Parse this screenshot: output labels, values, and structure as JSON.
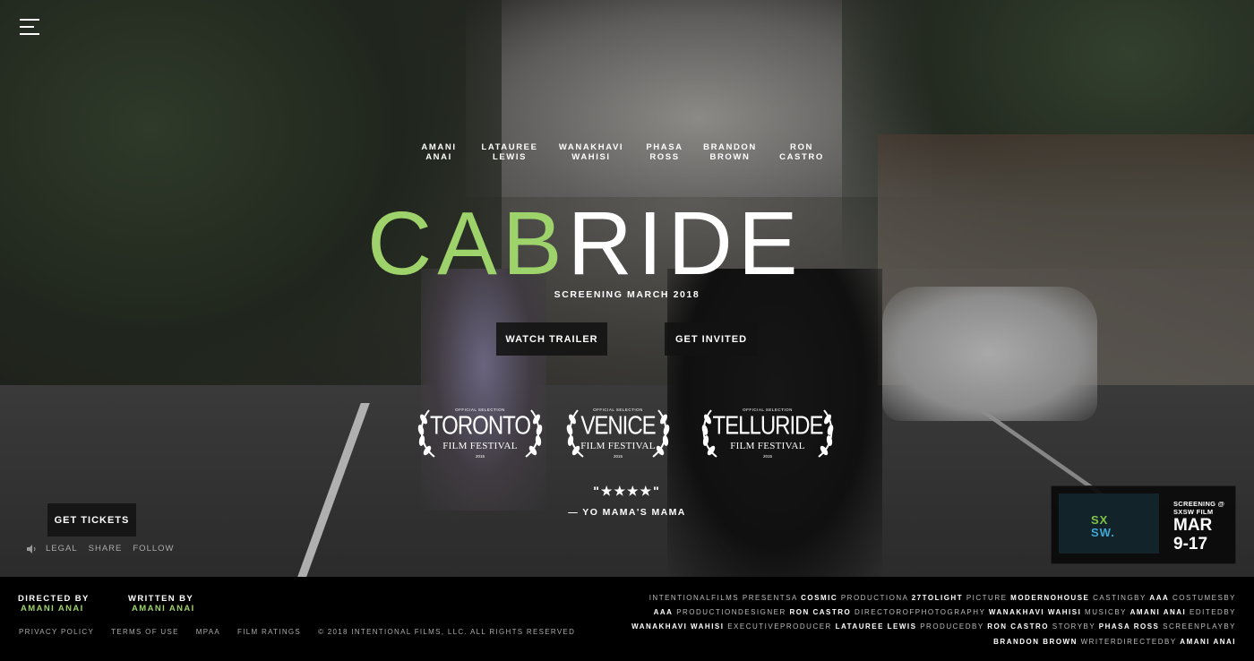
{
  "cast": [
    {
      "first": "AMANI",
      "last": "ANAI"
    },
    {
      "first": "LATAUREE",
      "last": "LEWIS"
    },
    {
      "first": "WANAKHAVI",
      "last": "WAHISI"
    },
    {
      "first": "PHASA",
      "last": "ROSS"
    },
    {
      "first": "BRANDON",
      "last": "BROWN"
    },
    {
      "first": "RON",
      "last": "CASTRO"
    }
  ],
  "title": {
    "part1": "CAB",
    "part2": "RIDE",
    "accent": "#9ed26a"
  },
  "screening": "SCREENING MARCH 2018",
  "buttons": {
    "trailer": "WATCH TRAILER",
    "invited": "GET INVITED",
    "tickets": "GET TICKETS"
  },
  "laurels": [
    {
      "selection": "OFFICIAL SELECTION",
      "name": "TORONTO",
      "festival": "FILM FESTIVAL",
      "year": "2015"
    },
    {
      "selection": "OFFICIAL SELECTION",
      "name": "VENICE",
      "festival": "FILM FESTIVAL",
      "year": "2015"
    },
    {
      "selection": "OFFICIAL SELECTION",
      "name": "TELLURIDE",
      "festival": "FILM FESTIVAL",
      "year": "2015"
    }
  ],
  "review": {
    "stars": "\"★★★★\"",
    "by": "— YO MAMA'S MAMA"
  },
  "mini_links": {
    "legal": "LEGAL",
    "share": "SHARE",
    "follow": "FOLLOW"
  },
  "sxsw": {
    "logo_line1": "SX",
    "logo_line2": "SW.",
    "screening_line1": "SCREENING @",
    "screening_line2": "SXSW FILM",
    "month": "MAR",
    "days": "9-17"
  },
  "footer": {
    "directed_label": "DIRECTED BY",
    "directed_name": "AMANI ANAI",
    "written_label": "WRITTEN BY",
    "written_name": "AMANI ANAI",
    "links": {
      "privacy": "PRIVACY POLICY",
      "terms": "TERMS OF USE",
      "mpaa": "MPAA",
      "ratings": "FILM RATINGS",
      "copyright": "© 2018 INTENTIONAL FILMS, LLC. ALL RIGHTS RESERVED"
    },
    "credits": [
      {
        "t": "INTENTIONALFILMS PRESENTSA ",
        "b": "COSMIC"
      },
      {
        "t": " PRODUCTIONA ",
        "b": "27TOLIGHT"
      },
      {
        "t": " PICTURE ",
        "b": "MODERNOHOUSE"
      },
      {
        "t": " CASTINGBY ",
        "b": "AAA"
      },
      {
        "t": " COSTUMESBY ",
        "b": "AAA"
      },
      {
        "t": " PRODUCTIONDESIGNER ",
        "b": "RON CASTRO"
      },
      {
        "t": " DIRECTOROFPHOTOGRAPHY ",
        "b": "WANAKHAVI WAHISI"
      },
      {
        "t": " MUSICBY ",
        "b": "AMANI ANAI"
      },
      {
        "t": " EDITEDBY ",
        "b": "WANAKHAVI WAHISI"
      },
      {
        "t": " EXECUTIVEPRODUCER ",
        "b": "LATAUREE LEWIS"
      },
      {
        "t": " PRODUCEDBY ",
        "b": "RON CASTRO"
      },
      {
        "t": " STORYBY ",
        "b": "PHASA ROSS"
      },
      {
        "t": " SCREENPLAYBY ",
        "b": "BRANDON BROWN"
      },
      {
        "t": " WRITERDIRECTEDBY ",
        "b": "AMANI ANAI"
      }
    ]
  }
}
